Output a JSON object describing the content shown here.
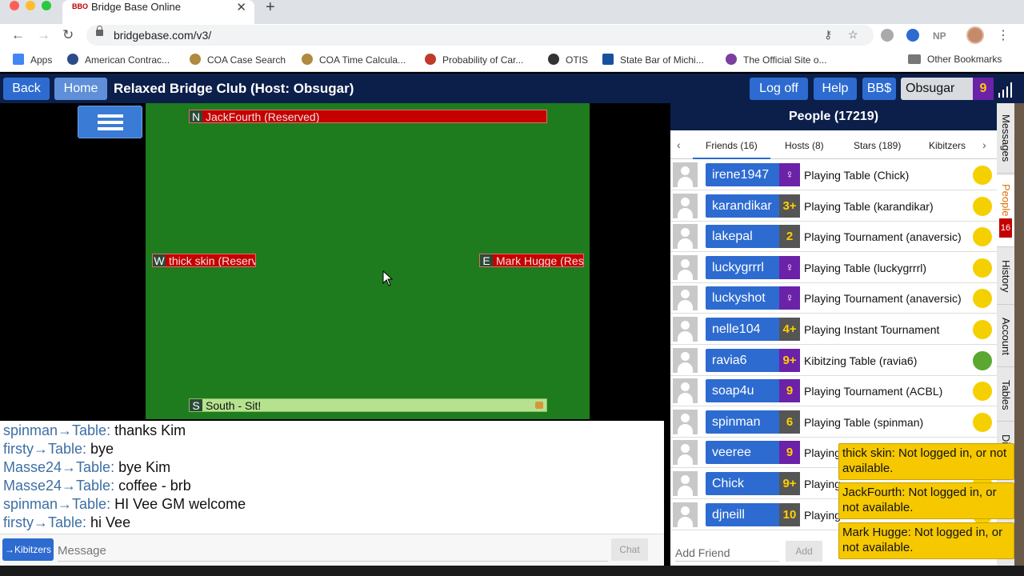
{
  "browser": {
    "tab_title": "Bridge Base Online",
    "tab_favicon": "BBO",
    "url": "bridgebase.com/v3/",
    "np_label": "NP",
    "bookmarks": [
      {
        "label": "Apps",
        "icon": "grid-icon",
        "color": "#4285f4"
      },
      {
        "label": "American Contrac...",
        "icon": "globe-icon",
        "color": "#2d4a8a"
      },
      {
        "label": "COA Case Search",
        "icon": "seal-icon",
        "color": "#b08a3e"
      },
      {
        "label": "COA Time Calcula...",
        "icon": "seal-icon",
        "color": "#b08a3e"
      },
      {
        "label": "Probability of Car...",
        "icon": "cards-icon",
        "color": "#c0392b"
      },
      {
        "label": "OTIS",
        "icon": "globe-icon",
        "color": "#333333"
      },
      {
        "label": "State Bar of Michi...",
        "icon": "flag-icon",
        "color": "#1a4fa0"
      },
      {
        "label": "The Official Site o...",
        "icon": "logo-icon",
        "color": "#7b3fa0"
      }
    ],
    "other_bookmarks": "Other Bookmarks"
  },
  "header": {
    "back": "Back",
    "home": "Home",
    "title": "Relaxed Bridge Club (Host: Obsugar)",
    "logoff": "Log off",
    "help": "Help",
    "bbdollars": "BB$",
    "username": "Obsugar",
    "user_level": "9"
  },
  "table": {
    "north": {
      "dir": "N",
      "label": "JackFourth (Reserved)"
    },
    "west": {
      "dir": "W",
      "label": "thick skin (Reserved)"
    },
    "east": {
      "dir": "E",
      "label": "Mark Hugge (Reserved)"
    },
    "south": {
      "dir": "S",
      "label": "South - Sit!"
    }
  },
  "chat": {
    "lines": [
      {
        "who": "spinman→Table:",
        "text": " thanks Kim"
      },
      {
        "who": "firsty→Table:",
        "text": " bye"
      },
      {
        "who": "Masse24→Table:",
        "text": " bye Kim"
      },
      {
        "who": "Masse24→Table:",
        "text": " coffee - brb"
      },
      {
        "who": "spinman→Table:",
        "text": " HI Vee GM welcome"
      },
      {
        "who": "firsty→Table:",
        "text": " hi Vee"
      }
    ],
    "kibitzers_button": "→Kibitzers",
    "message_placeholder": "Message",
    "chat_button": "Chat"
  },
  "people": {
    "title": "People (17219)",
    "tabs": [
      "Friends (16)",
      "Hosts (8)",
      "Stars (189)",
      "Kibitzers"
    ],
    "rows": [
      {
        "name": "irene1947",
        "badge": "♀",
        "badge_type": "purple",
        "status": "Playing Table (Chick)",
        "dot": "#f5d000"
      },
      {
        "name": "karandikar",
        "badge": "3+",
        "badge_type": "star",
        "status": "Playing Table (karandikar)",
        "dot": "#f5d000"
      },
      {
        "name": "lakepal",
        "badge": "2",
        "badge_type": "star",
        "status": "Playing Tournament (anaversic)",
        "dot": "#f5d000"
      },
      {
        "name": "luckygrrrl",
        "badge": "♀",
        "badge_type": "purple",
        "status": "Playing Table (luckygrrrl)",
        "dot": "#f5d000"
      },
      {
        "name": "luckyshot",
        "badge": "♀",
        "badge_type": "purple",
        "status": "Playing Tournament (anaversic)",
        "dot": "#f5d000"
      },
      {
        "name": "nelle104",
        "badge": "4+",
        "badge_type": "star",
        "status": "Playing Instant Tournament",
        "dot": "#f5d000"
      },
      {
        "name": "ravia6",
        "badge": "9+",
        "badge_type": "nine",
        "status": "Kibitzing Table (ravia6)",
        "dot": "#5aa832"
      },
      {
        "name": "soap4u",
        "badge": "9",
        "badge_type": "nine",
        "status": "Playing Tournament (ACBL)",
        "dot": "#f5d000"
      },
      {
        "name": "spinman",
        "badge": "6",
        "badge_type": "star",
        "status": "Playing Table (spinman)",
        "dot": "#f5d000"
      },
      {
        "name": "veeree",
        "badge": "9",
        "badge_type": "nine",
        "status": "Playing",
        "dot": "#f5d000"
      },
      {
        "name": "Chick",
        "badge": "9+",
        "badge_type": "star",
        "status": "Playing",
        "dot": "#f5d000"
      },
      {
        "name": "djneill",
        "badge": "10",
        "badge_type": "star",
        "status": "Playing",
        "dot": "#f5d000"
      }
    ],
    "add_friend_placeholder": "Add Friend",
    "add_button": "Add"
  },
  "sidetabs": [
    {
      "label": "Messages",
      "active": false
    },
    {
      "label": "People",
      "active": true,
      "badge": "16"
    },
    {
      "label": "History",
      "active": false
    },
    {
      "label": "Account",
      "active": false
    },
    {
      "label": "Tables",
      "active": false
    },
    {
      "label": "Di",
      "active": false
    }
  ],
  "toasts": [
    "thick skin: Not logged in, or not available.",
    "JackFourth: Not logged in, or not available.",
    "Mark Hugge: Not logged in, or not available."
  ]
}
